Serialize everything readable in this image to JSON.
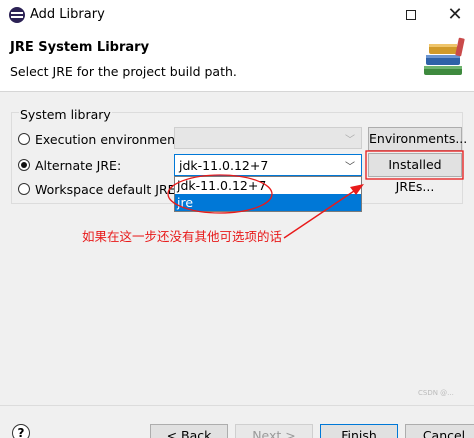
{
  "window": {
    "title": "Add Library",
    "maximize_label": "",
    "close_label": "✕"
  },
  "banner": {
    "title": "JRE System Library",
    "description": "Select JRE for the project build path."
  },
  "group": {
    "label": "System library"
  },
  "options": {
    "execution_env": {
      "label": "Execution environment:",
      "button": "Environments..."
    },
    "alternate_jre": {
      "label": "Alternate JRE:",
      "value": "jdk-11.0.12+7",
      "button": "Installed JREs..."
    },
    "workspace_default": {
      "label": "Workspace default JRE (jr"
    }
  },
  "dropdown": {
    "items": [
      "jdk-11.0.12+7",
      "jre"
    ]
  },
  "annotation": {
    "text": "如果在这一步还没有其他可选项的话",
    "color": "#e81a1a"
  },
  "footer": {
    "help_label": "?",
    "back_label": "< Back",
    "next_label": "Next >",
    "finish_label": "Finish",
    "cancel_label": "Cancel"
  },
  "watermark": "CSDN @..."
}
